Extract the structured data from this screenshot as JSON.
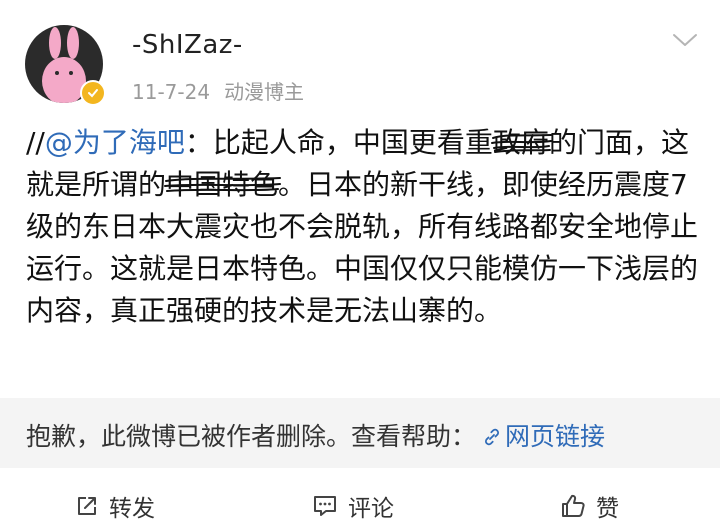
{
  "post": {
    "username": "-ShIZaz-",
    "date": "11-7-24",
    "source": "动漫博主"
  },
  "content": {
    "prefix": "//",
    "mention": "@为了海吧",
    "colon": "：",
    "part1": "比起人命，中国更看重",
    "struck1": "政府",
    "part2": "的门面，这就是所谓的",
    "struck2": "中国特色",
    "part3": "。日本的新干线，即使经历震度7级的东日本大震灾也不会脱轨，所有线路都安全地停止运行。这就是日本特色。中国仅仅只能模仿一下浅层的内容，真正强硬的技术是无法山寨的。"
  },
  "deleted": {
    "message": "抱歉，此微博已被作者删除。查看帮助：",
    "link_label": "网页链接"
  },
  "actions": {
    "repost": "转发",
    "comment": "评论",
    "like": "赞"
  },
  "colors": {
    "link": "#2f6bb8",
    "verified_badge": "#f3b61f",
    "avatar_bg": "#2b2b2b",
    "avatar_figure": "#f4a9c8",
    "deleted_bar_bg": "#f4f4f4"
  },
  "icons": {
    "verified": "verified-badge-icon",
    "menu": "chevron-down-icon",
    "link": "link-icon",
    "repost": "share-icon",
    "comment": "comment-icon",
    "like": "thumbs-up-icon"
  }
}
